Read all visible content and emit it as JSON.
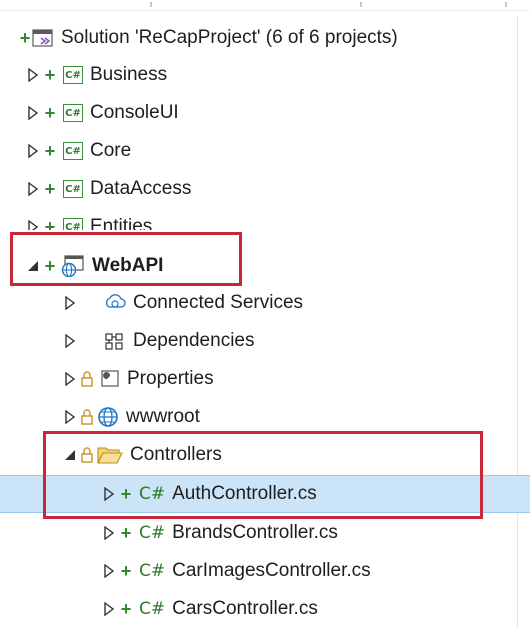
{
  "solution": {
    "label": "Solution 'ReCapProject' (6 of 6 projects)"
  },
  "projects": [
    {
      "label": "Business"
    },
    {
      "label": "ConsoleUI"
    },
    {
      "label": "Core"
    },
    {
      "label": "DataAccess"
    },
    {
      "label": "Entities"
    }
  ],
  "webapi": {
    "label": "WebAPI",
    "children": [
      {
        "label": "Connected Services"
      },
      {
        "label": "Dependencies"
      },
      {
        "label": "Properties"
      },
      {
        "label": "wwwroot"
      },
      {
        "label": "Controllers"
      }
    ]
  },
  "controllers": [
    {
      "label": "AuthController.cs"
    },
    {
      "label": "BrandsController.cs"
    },
    {
      "label": "CarImagesController.cs"
    },
    {
      "label": "CarsController.cs"
    }
  ],
  "icon_text": {
    "cs_box": "C#",
    "cs_plain": "C#",
    "plus": "+"
  },
  "colors": {
    "selection": "#cce4f7",
    "highlight_box": "#c8283a",
    "cs_green": "#2e7a2e",
    "folder": "#dcb35c",
    "globe": "#1f74c8"
  }
}
